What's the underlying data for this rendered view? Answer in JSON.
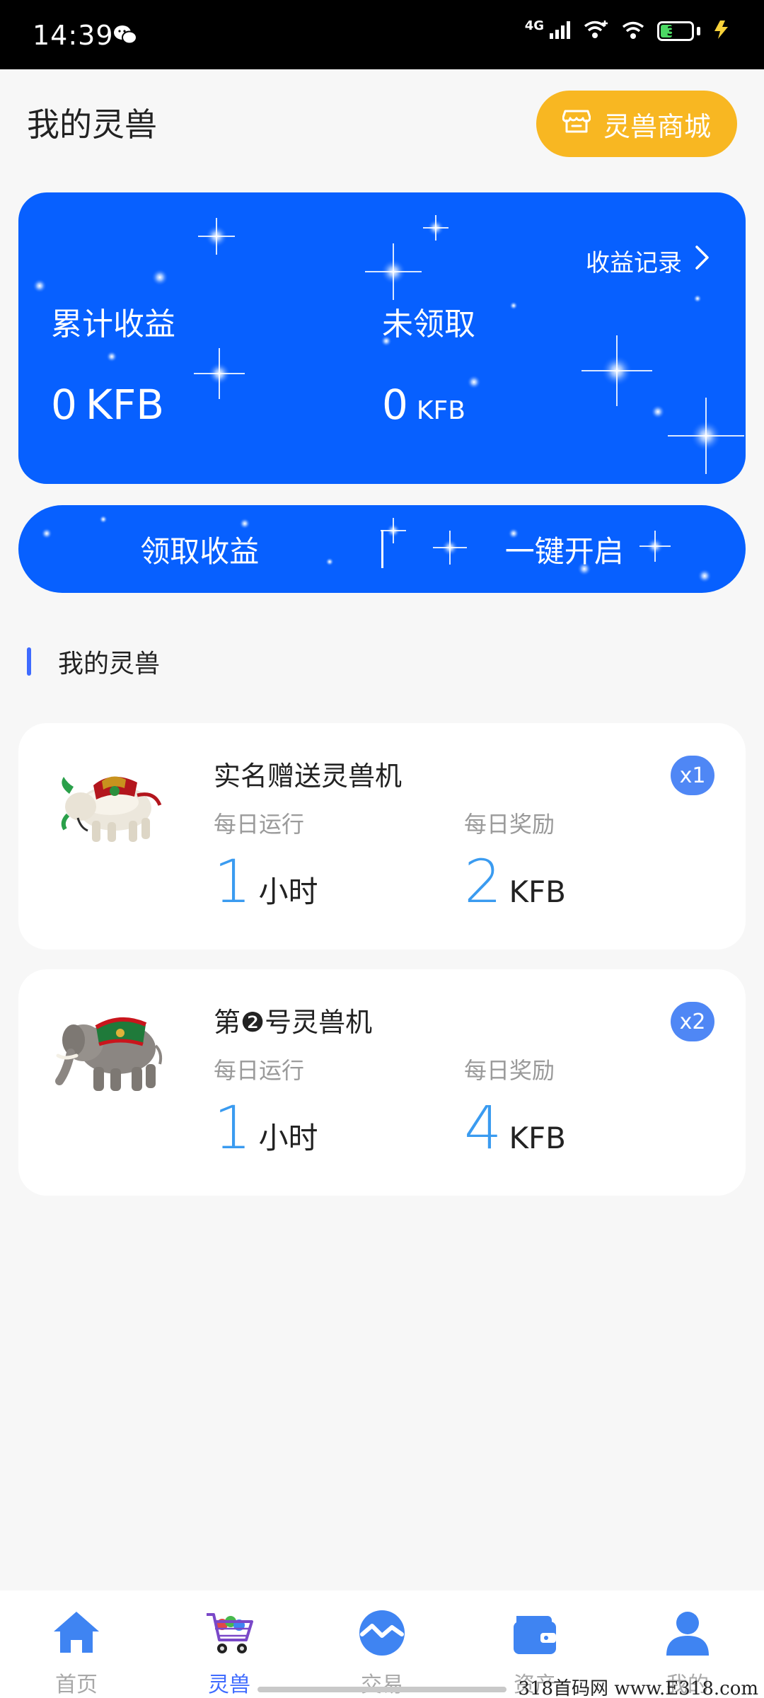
{
  "status": {
    "time": "14:39",
    "network": "4G",
    "battery": "37",
    "battery_level": 0.37
  },
  "header": {
    "title": "我的灵兽",
    "shop_label": "灵兽商城"
  },
  "earnings": {
    "record_label": "收益记录",
    "total_label": "累计收益",
    "total_value": "0",
    "total_unit": "KFB",
    "unclaimed_label": "未领取",
    "unclaimed_value": "0",
    "unclaimed_unit": "KFB"
  },
  "actions": {
    "claim_label": "领取收益",
    "start_label": "一键开启"
  },
  "section": {
    "title": "我的灵兽"
  },
  "beasts": [
    {
      "name": "实名赠送灵兽机",
      "badge": "x1",
      "run_label": "每日运行",
      "run_value": "1",
      "run_unit": "小时",
      "reward_label": "每日奖励",
      "reward_value": "2",
      "reward_unit": "KFB"
    },
    {
      "name": "第❷号灵兽机",
      "badge": "x2",
      "run_label": "每日运行",
      "run_value": "1",
      "run_unit": "小时",
      "reward_label": "每日奖励",
      "reward_value": "4",
      "reward_unit": "KFB"
    }
  ],
  "nav": [
    {
      "label": "首页",
      "icon": "home-icon"
    },
    {
      "label": "灵兽",
      "icon": "cart-icon"
    },
    {
      "label": "交易",
      "icon": "trade-icon"
    },
    {
      "label": "资产",
      "icon": "wallet-icon"
    },
    {
      "label": "我的",
      "icon": "user-icon"
    }
  ],
  "watermark": "318首码网  www.E318.com",
  "colors": {
    "primary_blue": "#0760ff",
    "accent_orange": "#f8b722",
    "number_blue": "#3a9bf0",
    "badge_blue": "#4f87f5",
    "nav_active": "#3f6bff"
  }
}
